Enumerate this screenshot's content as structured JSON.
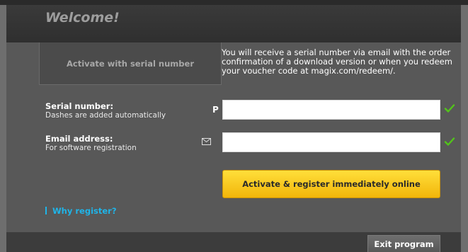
{
  "header": {
    "title": "Welcome!"
  },
  "tab": {
    "label": "Activate with serial number"
  },
  "info": {
    "text": "You will receive a serial number via email with the order confirmation of a download version or when you redeem your voucher code at magix.com/redeem/."
  },
  "serial": {
    "title": "Serial number:",
    "subtitle": "Dashes are added automatically",
    "prefix": "P",
    "value": "",
    "valid": true
  },
  "email": {
    "title": "Email address:",
    "subtitle": "For software registration",
    "icon": "envelope-icon",
    "value": "",
    "valid": true
  },
  "actions": {
    "activate_label": "Activate & register immediately online",
    "why_label": "Why register?",
    "exit_label": "Exit program"
  },
  "colors": {
    "accent_yellow": "#f7c614",
    "link_blue": "#1fb4e8",
    "check_green": "#52c41a"
  }
}
